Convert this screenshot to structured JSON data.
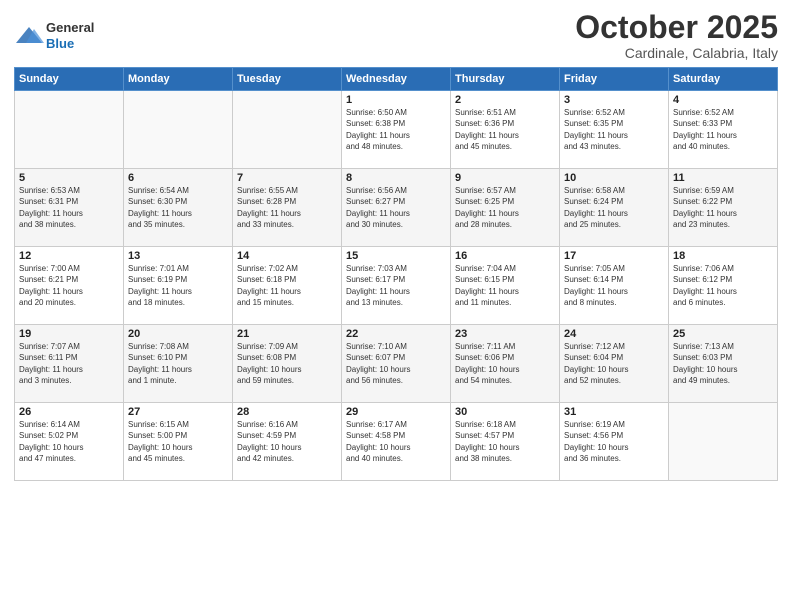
{
  "header": {
    "logo": {
      "general": "General",
      "blue": "Blue"
    },
    "title": "October 2025",
    "location": "Cardinale, Calabria, Italy"
  },
  "days_of_week": [
    "Sunday",
    "Monday",
    "Tuesday",
    "Wednesday",
    "Thursday",
    "Friday",
    "Saturday"
  ],
  "weeks": [
    [
      {
        "day": "",
        "info": ""
      },
      {
        "day": "",
        "info": ""
      },
      {
        "day": "",
        "info": ""
      },
      {
        "day": "1",
        "info": "Sunrise: 6:50 AM\nSunset: 6:38 PM\nDaylight: 11 hours\nand 48 minutes."
      },
      {
        "day": "2",
        "info": "Sunrise: 6:51 AM\nSunset: 6:36 PM\nDaylight: 11 hours\nand 45 minutes."
      },
      {
        "day": "3",
        "info": "Sunrise: 6:52 AM\nSunset: 6:35 PM\nDaylight: 11 hours\nand 43 minutes."
      },
      {
        "day": "4",
        "info": "Sunrise: 6:52 AM\nSunset: 6:33 PM\nDaylight: 11 hours\nand 40 minutes."
      }
    ],
    [
      {
        "day": "5",
        "info": "Sunrise: 6:53 AM\nSunset: 6:31 PM\nDaylight: 11 hours\nand 38 minutes."
      },
      {
        "day": "6",
        "info": "Sunrise: 6:54 AM\nSunset: 6:30 PM\nDaylight: 11 hours\nand 35 minutes."
      },
      {
        "day": "7",
        "info": "Sunrise: 6:55 AM\nSunset: 6:28 PM\nDaylight: 11 hours\nand 33 minutes."
      },
      {
        "day": "8",
        "info": "Sunrise: 6:56 AM\nSunset: 6:27 PM\nDaylight: 11 hours\nand 30 minutes."
      },
      {
        "day": "9",
        "info": "Sunrise: 6:57 AM\nSunset: 6:25 PM\nDaylight: 11 hours\nand 28 minutes."
      },
      {
        "day": "10",
        "info": "Sunrise: 6:58 AM\nSunset: 6:24 PM\nDaylight: 11 hours\nand 25 minutes."
      },
      {
        "day": "11",
        "info": "Sunrise: 6:59 AM\nSunset: 6:22 PM\nDaylight: 11 hours\nand 23 minutes."
      }
    ],
    [
      {
        "day": "12",
        "info": "Sunrise: 7:00 AM\nSunset: 6:21 PM\nDaylight: 11 hours\nand 20 minutes."
      },
      {
        "day": "13",
        "info": "Sunrise: 7:01 AM\nSunset: 6:19 PM\nDaylight: 11 hours\nand 18 minutes."
      },
      {
        "day": "14",
        "info": "Sunrise: 7:02 AM\nSunset: 6:18 PM\nDaylight: 11 hours\nand 15 minutes."
      },
      {
        "day": "15",
        "info": "Sunrise: 7:03 AM\nSunset: 6:17 PM\nDaylight: 11 hours\nand 13 minutes."
      },
      {
        "day": "16",
        "info": "Sunrise: 7:04 AM\nSunset: 6:15 PM\nDaylight: 11 hours\nand 11 minutes."
      },
      {
        "day": "17",
        "info": "Sunrise: 7:05 AM\nSunset: 6:14 PM\nDaylight: 11 hours\nand 8 minutes."
      },
      {
        "day": "18",
        "info": "Sunrise: 7:06 AM\nSunset: 6:12 PM\nDaylight: 11 hours\nand 6 minutes."
      }
    ],
    [
      {
        "day": "19",
        "info": "Sunrise: 7:07 AM\nSunset: 6:11 PM\nDaylight: 11 hours\nand 3 minutes."
      },
      {
        "day": "20",
        "info": "Sunrise: 7:08 AM\nSunset: 6:10 PM\nDaylight: 11 hours\nand 1 minute."
      },
      {
        "day": "21",
        "info": "Sunrise: 7:09 AM\nSunset: 6:08 PM\nDaylight: 10 hours\nand 59 minutes."
      },
      {
        "day": "22",
        "info": "Sunrise: 7:10 AM\nSunset: 6:07 PM\nDaylight: 10 hours\nand 56 minutes."
      },
      {
        "day": "23",
        "info": "Sunrise: 7:11 AM\nSunset: 6:06 PM\nDaylight: 10 hours\nand 54 minutes."
      },
      {
        "day": "24",
        "info": "Sunrise: 7:12 AM\nSunset: 6:04 PM\nDaylight: 10 hours\nand 52 minutes."
      },
      {
        "day": "25",
        "info": "Sunrise: 7:13 AM\nSunset: 6:03 PM\nDaylight: 10 hours\nand 49 minutes."
      }
    ],
    [
      {
        "day": "26",
        "info": "Sunrise: 6:14 AM\nSunset: 5:02 PM\nDaylight: 10 hours\nand 47 minutes."
      },
      {
        "day": "27",
        "info": "Sunrise: 6:15 AM\nSunset: 5:00 PM\nDaylight: 10 hours\nand 45 minutes."
      },
      {
        "day": "28",
        "info": "Sunrise: 6:16 AM\nSunset: 4:59 PM\nDaylight: 10 hours\nand 42 minutes."
      },
      {
        "day": "29",
        "info": "Sunrise: 6:17 AM\nSunset: 4:58 PM\nDaylight: 10 hours\nand 40 minutes."
      },
      {
        "day": "30",
        "info": "Sunrise: 6:18 AM\nSunset: 4:57 PM\nDaylight: 10 hours\nand 38 minutes."
      },
      {
        "day": "31",
        "info": "Sunrise: 6:19 AM\nSunset: 4:56 PM\nDaylight: 10 hours\nand 36 minutes."
      },
      {
        "day": "",
        "info": ""
      }
    ]
  ]
}
